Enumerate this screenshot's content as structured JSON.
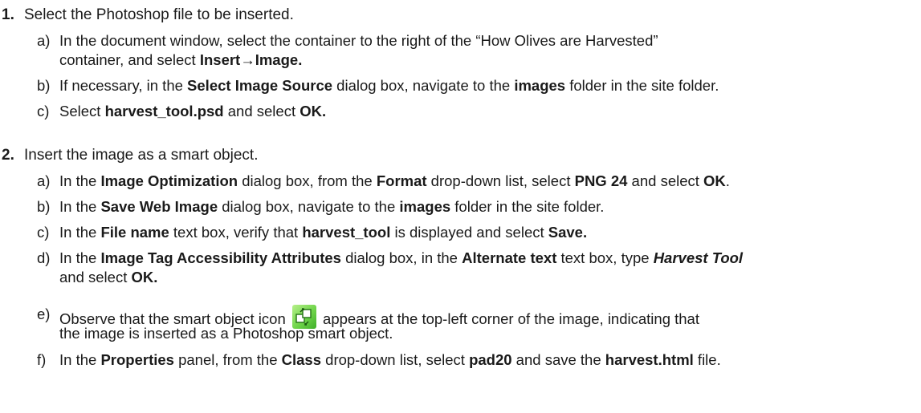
{
  "steps": [
    {
      "number": "1.",
      "text": "Select the Photoshop file to be inserted.",
      "substeps": [
        {
          "letter": "a)",
          "parts": [
            "In the document window, select the container to the right of the “How Olives are Harvested”"
          ],
          "cont_parts": [
            "container, and select ",
            "Insert→Image."
          ]
        },
        {
          "letter": "b)",
          "parts": [
            "If necessary, in the ",
            "Select Image Source",
            " dialog box, navigate to the ",
            "images",
            " folder in the site folder."
          ]
        },
        {
          "letter": "c)",
          "parts": [
            "Select ",
            "harvest_tool.psd",
            " and select ",
            "OK."
          ]
        }
      ]
    },
    {
      "number": "2.",
      "text": "Insert the image as a smart object.",
      "substeps": [
        {
          "letter": "a)",
          "parts": [
            "In the ",
            "Image Optimization",
            " dialog box, from the ",
            "Format",
            " drop-down list, select ",
            "PNG 24",
            " and select ",
            "OK",
            "."
          ]
        },
        {
          "letter": "b)",
          "parts": [
            "In the ",
            "Save Web Image",
            " dialog box, navigate to the ",
            "images",
            " folder in the site folder."
          ]
        },
        {
          "letter": "c)",
          "parts": [
            "In the ",
            "File name",
            " text box, verify that ",
            "harvest_tool",
            " is displayed and select ",
            "Save."
          ]
        },
        {
          "letter": "d)",
          "parts": [
            "In the ",
            "Image Tag Accessibility Attributes",
            " dialog box, in the ",
            "Alternate text",
            " text box, type ",
            "Harvest Tool"
          ],
          "cont_parts": [
            "and select ",
            "OK."
          ]
        },
        {
          "letter": "e)",
          "parts": [
            "Observe that the smart object icon ",
            " appears at the top-left corner of the image, indicating that"
          ],
          "cont_parts": [
            "the image is inserted as a Photoshop smart object."
          ],
          "icon": "smart-object-icon"
        },
        {
          "letter": "f)",
          "parts": [
            "In the ",
            "Properties",
            " panel, from the ",
            "Class",
            " drop-down list, select ",
            "pad20",
            " and save the ",
            "harvest.html",
            " file."
          ]
        }
      ]
    }
  ]
}
